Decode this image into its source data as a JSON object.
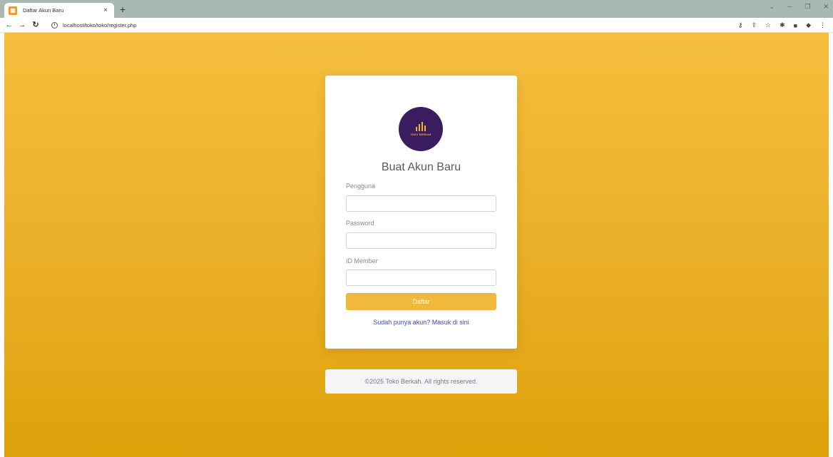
{
  "browser": {
    "tab_title": "Daftar Akun Baru",
    "tab_close": "×",
    "new_tab": "+",
    "url": "localhost/toko/toko/register.php"
  },
  "icons": [
    "back-icon",
    "forward-icon",
    "reload-icon",
    "info-icon",
    "key-icon",
    "share-icon",
    "star-icon",
    "extensions-icon",
    "sidepanel-icon",
    "profile-icon",
    "menu-icon"
  ],
  "colors": {
    "page_gradient_top": "#f5be3c",
    "page_gradient_bottom": "#dea10a",
    "logo_bg": "#3a1d5e",
    "accent": "#f1b93b",
    "link": "#3d4ea0"
  },
  "card": {
    "logo_text": "TOKO BERKAH",
    "title": "Buat Akun Baru",
    "fields": [
      {
        "label": "Pengguna",
        "value": "",
        "placeholder": ""
      },
      {
        "label": "Password",
        "value": "",
        "placeholder": ""
      },
      {
        "label": "ID Member",
        "value": "",
        "placeholder": ""
      }
    ],
    "submit_label": "Daftar",
    "login_link": "Sudah punya akun? Masuk di sini"
  },
  "footer": {
    "text": "©2025 Toko Berkah. All rights reserved."
  }
}
